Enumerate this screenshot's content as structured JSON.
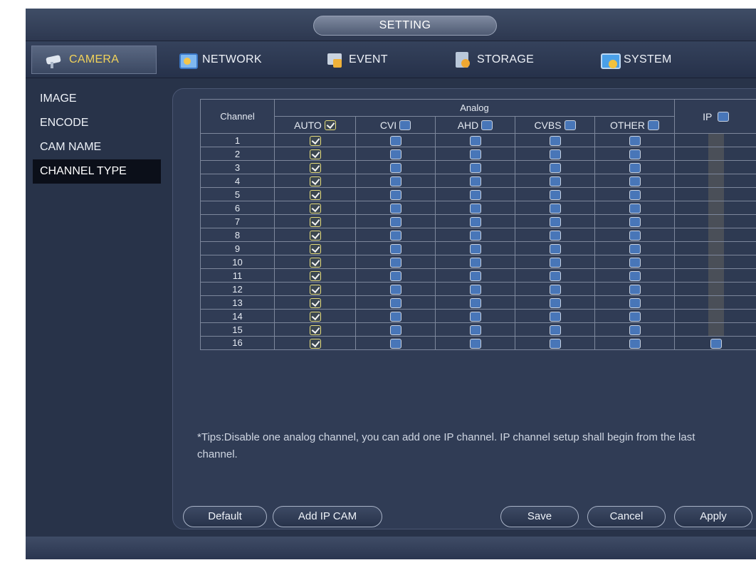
{
  "title": "SETTING",
  "tabs": [
    {
      "label": "CAMERA",
      "icon": "camera-icon",
      "active": true
    },
    {
      "label": "NETWORK",
      "icon": "network-icon"
    },
    {
      "label": "EVENT",
      "icon": "event-icon"
    },
    {
      "label": "STORAGE",
      "icon": "storage-icon"
    },
    {
      "label": "SYSTEM",
      "icon": "system-icon"
    }
  ],
  "sidebar": {
    "items": [
      {
        "label": "IMAGE"
      },
      {
        "label": "ENCODE"
      },
      {
        "label": "CAM NAME"
      },
      {
        "label": "CHANNEL TYPE",
        "active": true
      }
    ]
  },
  "table": {
    "channel_header": "Channel",
    "analog_header": "Analog",
    "ip_header": "IP",
    "columns": [
      {
        "label": "AUTO",
        "checked": true
      },
      {
        "label": "CVI",
        "checked": false
      },
      {
        "label": "AHD",
        "checked": false
      },
      {
        "label": "CVBS",
        "checked": false
      },
      {
        "label": "OTHER",
        "checked": false
      }
    ],
    "ip_checked": false,
    "rows": [
      {
        "channel": "1"
      },
      {
        "channel": "2"
      },
      {
        "channel": "3"
      },
      {
        "channel": "4"
      },
      {
        "channel": "5"
      },
      {
        "channel": "6"
      },
      {
        "channel": "7"
      },
      {
        "channel": "8"
      },
      {
        "channel": "9"
      },
      {
        "channel": "10"
      },
      {
        "channel": "11"
      },
      {
        "channel": "12"
      },
      {
        "channel": "13"
      },
      {
        "channel": "14"
      },
      {
        "channel": "15"
      },
      {
        "channel": "16"
      }
    ]
  },
  "tips": "*Tips:Disable one analog channel, you can add one IP channel. IP channel setup shall begin from the last channel.",
  "buttons": {
    "default": "Default",
    "add_ip_cam": "Add IP CAM",
    "save": "Save",
    "cancel": "Cancel",
    "apply": "Apply"
  },
  "colors": {
    "active_tab_text": "#f2d35a",
    "background": "#283349",
    "checkbox_unchecked": "#4876b8"
  }
}
